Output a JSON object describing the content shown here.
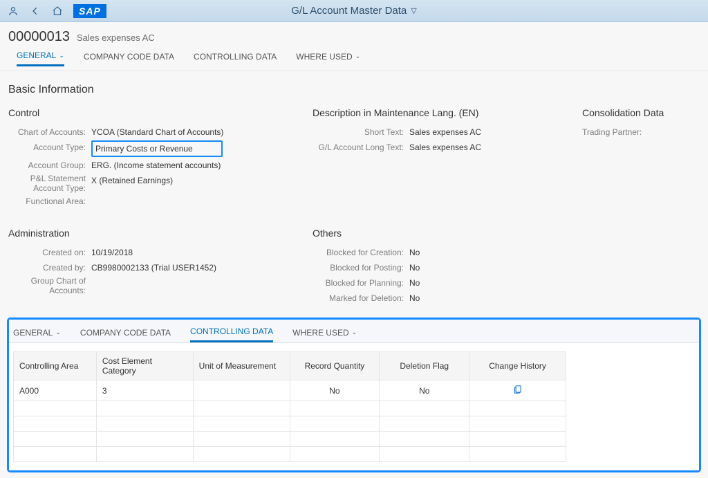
{
  "topbar": {
    "title": "G/L Account Master Data"
  },
  "header": {
    "id": "00000013",
    "desc": "Sales expenses AC"
  },
  "tabsMain": {
    "general": "GENERAL",
    "company": "COMPANY CODE DATA",
    "controlling": "CONTROLLING DATA",
    "whereused": "WHERE USED"
  },
  "section": {
    "basic": "Basic Information"
  },
  "control": {
    "title": "Control",
    "chartOfAccounts_label": "Chart of Accounts:",
    "chartOfAccounts_value": "YCOA (Standard Chart of Accounts)",
    "accountType_label": "Account Type:",
    "accountType_value": "Primary Costs or Revenue",
    "accountGroup_label": "Account Group:",
    "accountGroup_value": "ERG. (Income statement accounts)",
    "pl_label_a": "P&L Statement",
    "pl_label_b": "Account Type:",
    "pl_value": "X (Retained Earnings)",
    "functionalArea_label": "Functional Area:",
    "functionalArea_value": ""
  },
  "descLang": {
    "title": "Description in Maintenance Lang. (EN)",
    "shortText_label": "Short Text:",
    "shortText_value": "Sales expenses AC",
    "longText_label": "G/L Account Long Text:",
    "longText_value": "Sales expenses AC"
  },
  "consolidation": {
    "title": "Consolidation Data",
    "tradingPartner_label": "Trading Partner:",
    "tradingPartner_value": ""
  },
  "admin": {
    "title": "Administration",
    "createdOn_label": "Created on:",
    "createdOn_value": "10/19/2018",
    "createdBy_label": "Created by:",
    "createdBy_value": "CB9980002133 (Trial USER1452)",
    "groupChart_label_a": "Group Chart of",
    "groupChart_label_b": "Accounts:",
    "groupChart_value": ""
  },
  "others": {
    "title": "Others",
    "blockedCreation_label": "Blocked for Creation:",
    "blockedCreation_value": "No",
    "blockedPosting_label": "Blocked for Posting:",
    "blockedPosting_value": "No",
    "blockedPlanning_label": "Blocked for Planning:",
    "blockedPlanning_value": "No",
    "markedDeletion_label": "Marked for Deletion:",
    "markedDeletion_value": "No"
  },
  "lowerTable": {
    "columns": {
      "c1": "Controlling Area",
      "c2": "Cost Element Category",
      "c3": "Unit of Measurement",
      "c4": "Record Quantity",
      "c5": "Deletion Flag",
      "c6": "Change History"
    },
    "row1": {
      "controllingArea": "A000",
      "costElementCategory": "3",
      "unitOfMeasurement": "",
      "recordQuantity": "No",
      "deletionFlag": "No"
    }
  }
}
